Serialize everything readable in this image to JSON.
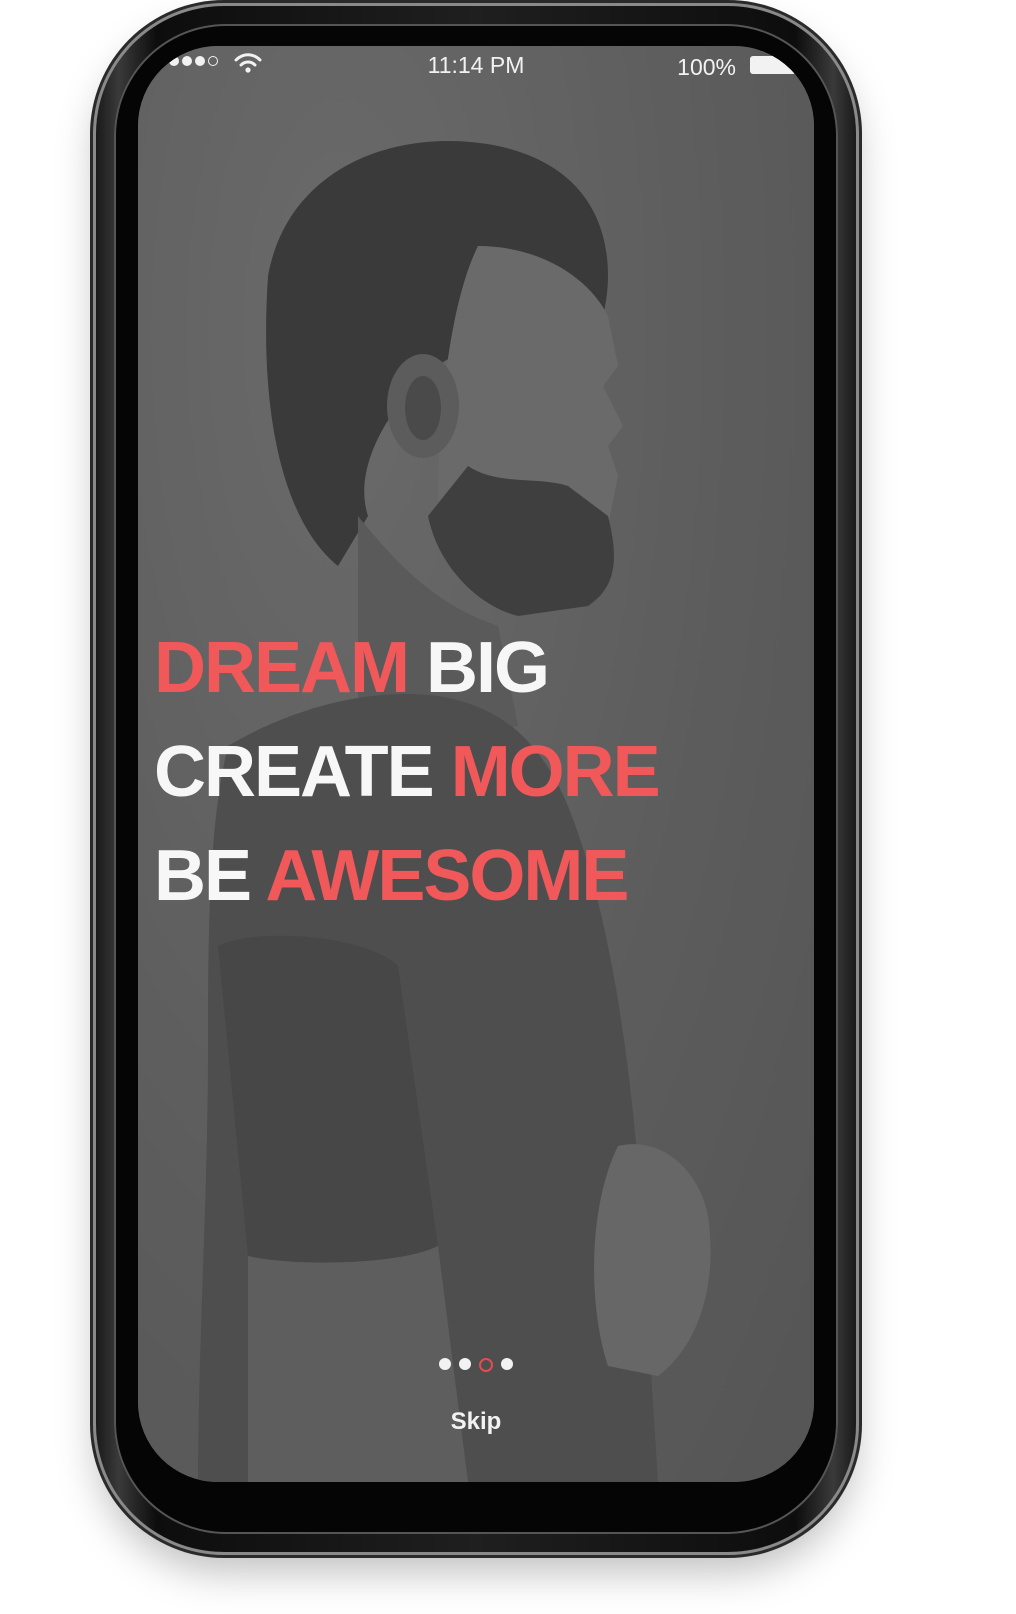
{
  "status_bar": {
    "time": "11:14 PM",
    "battery_percent": "100%",
    "signal_bars_filled": 4,
    "signal_bars_total": 5
  },
  "headline": {
    "line1": {
      "part1": "DREAM",
      "part2": "BIG"
    },
    "line2": {
      "part1": "CREATE",
      "part2": "MORE"
    },
    "line3": {
      "part1": "BE",
      "part2": "AWESOME"
    }
  },
  "pager": {
    "total": 4,
    "active_index": 2
  },
  "skip_label": "Skip",
  "colors": {
    "accent_red": "#f0585a",
    "text_white": "#f7f7f7",
    "overlay_gray": "#606060"
  },
  "icons": {
    "wifi": "wifi-icon",
    "battery": "battery-icon"
  }
}
